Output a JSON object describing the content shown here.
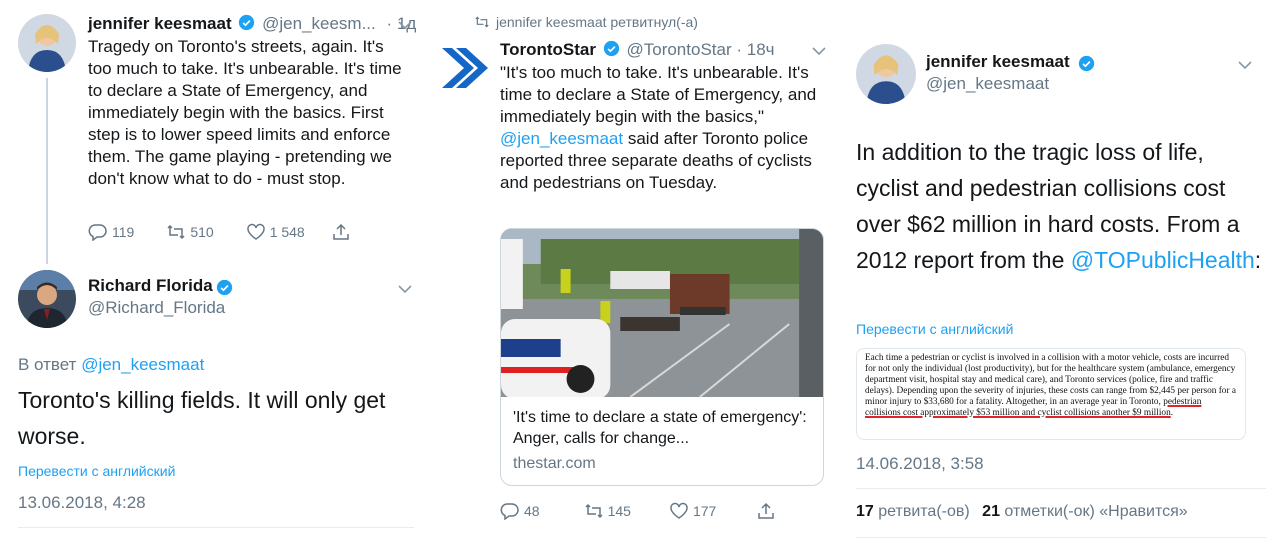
{
  "panel1": {
    "tweet1": {
      "name": "jennifer keesmaat",
      "handle": "@jen_keesm...",
      "time": "· 1д",
      "text": "Tragedy on Toronto's streets, again. It's too much to take. It's unbearable. It's time to declare a State of Emergency, and immediately begin with the basics. First step is to lower speed limits and enforce them. The game playing - pretending we don't know what to do - must stop.",
      "replies": "119",
      "retweets": "510",
      "likes": "1 548"
    },
    "tweet2": {
      "name": "Richard Florida",
      "handle": "@Richard_Florida",
      "reply_prefix": "В ответ",
      "reply_to": "@jen_keesmaat",
      "text": "Toronto's killing fields. It will only get worse.",
      "translate": "Перевести с английский",
      "timestamp": "13.06.2018, 4:28"
    }
  },
  "panel2": {
    "retweeted_by": "jennifer keesmaat ретвитнул(-а)",
    "name": "TorontoStar",
    "handle": "@TorontoStar",
    "time": "· 18ч",
    "text_before": "\"It's too much to take. It's unbearable. It's time to declare a State of Emergency, and immediately begin with the basics,\"",
    "mention": "@jen_keesmaat",
    "text_after": "said after Toronto police reported three separate deaths of cyclists and pedestrians on Tuesday.",
    "card": {
      "title": "'It's time to declare a state of emergency': Anger, calls for change...",
      "domain": "thestar.com"
    },
    "replies": "48",
    "retweets": "145",
    "likes": "177"
  },
  "panel3": {
    "name": "jennifer keesmaat",
    "handle": "@jen_keesmaat",
    "text": "In addition to the tragic loss of life, cyclist and pedestrian collisions cost over $62 million in hard costs. From a 2012 report from the",
    "mention": "@TOPublicHealth",
    "text_end": ":",
    "translate": "Перевести с английский",
    "report": {
      "line1": "Each time a pedestrian or cyclist is involved in a collision with a motor vehicle, costs are incurred for not only the individual (lost productivity), but for the healthcare system (ambulance, emergency department visit, hospital stay and medical care), and Toronto services (police, fire and traffic delays). Depending upon the severity of injuries, these costs can range from $2,445 per person for a minor injury to $33,680 for a fatality. Altogether, in an average year in Toronto,",
      "underlined": "pedestrian collisions cost approximately $53 million and cyclist collisions another $9 million",
      "end": "."
    },
    "timestamp": "14.06.2018, 3:58",
    "retweet_count": "17",
    "retweet_label": "ретвита(-ов)",
    "like_count": "21",
    "like_label": "отметки(-ок) «Нравится»"
  },
  "colors": {
    "link": "#1da1f2",
    "secondary": "#657786",
    "text": "#14171a",
    "star_blue": "#1467c6"
  }
}
